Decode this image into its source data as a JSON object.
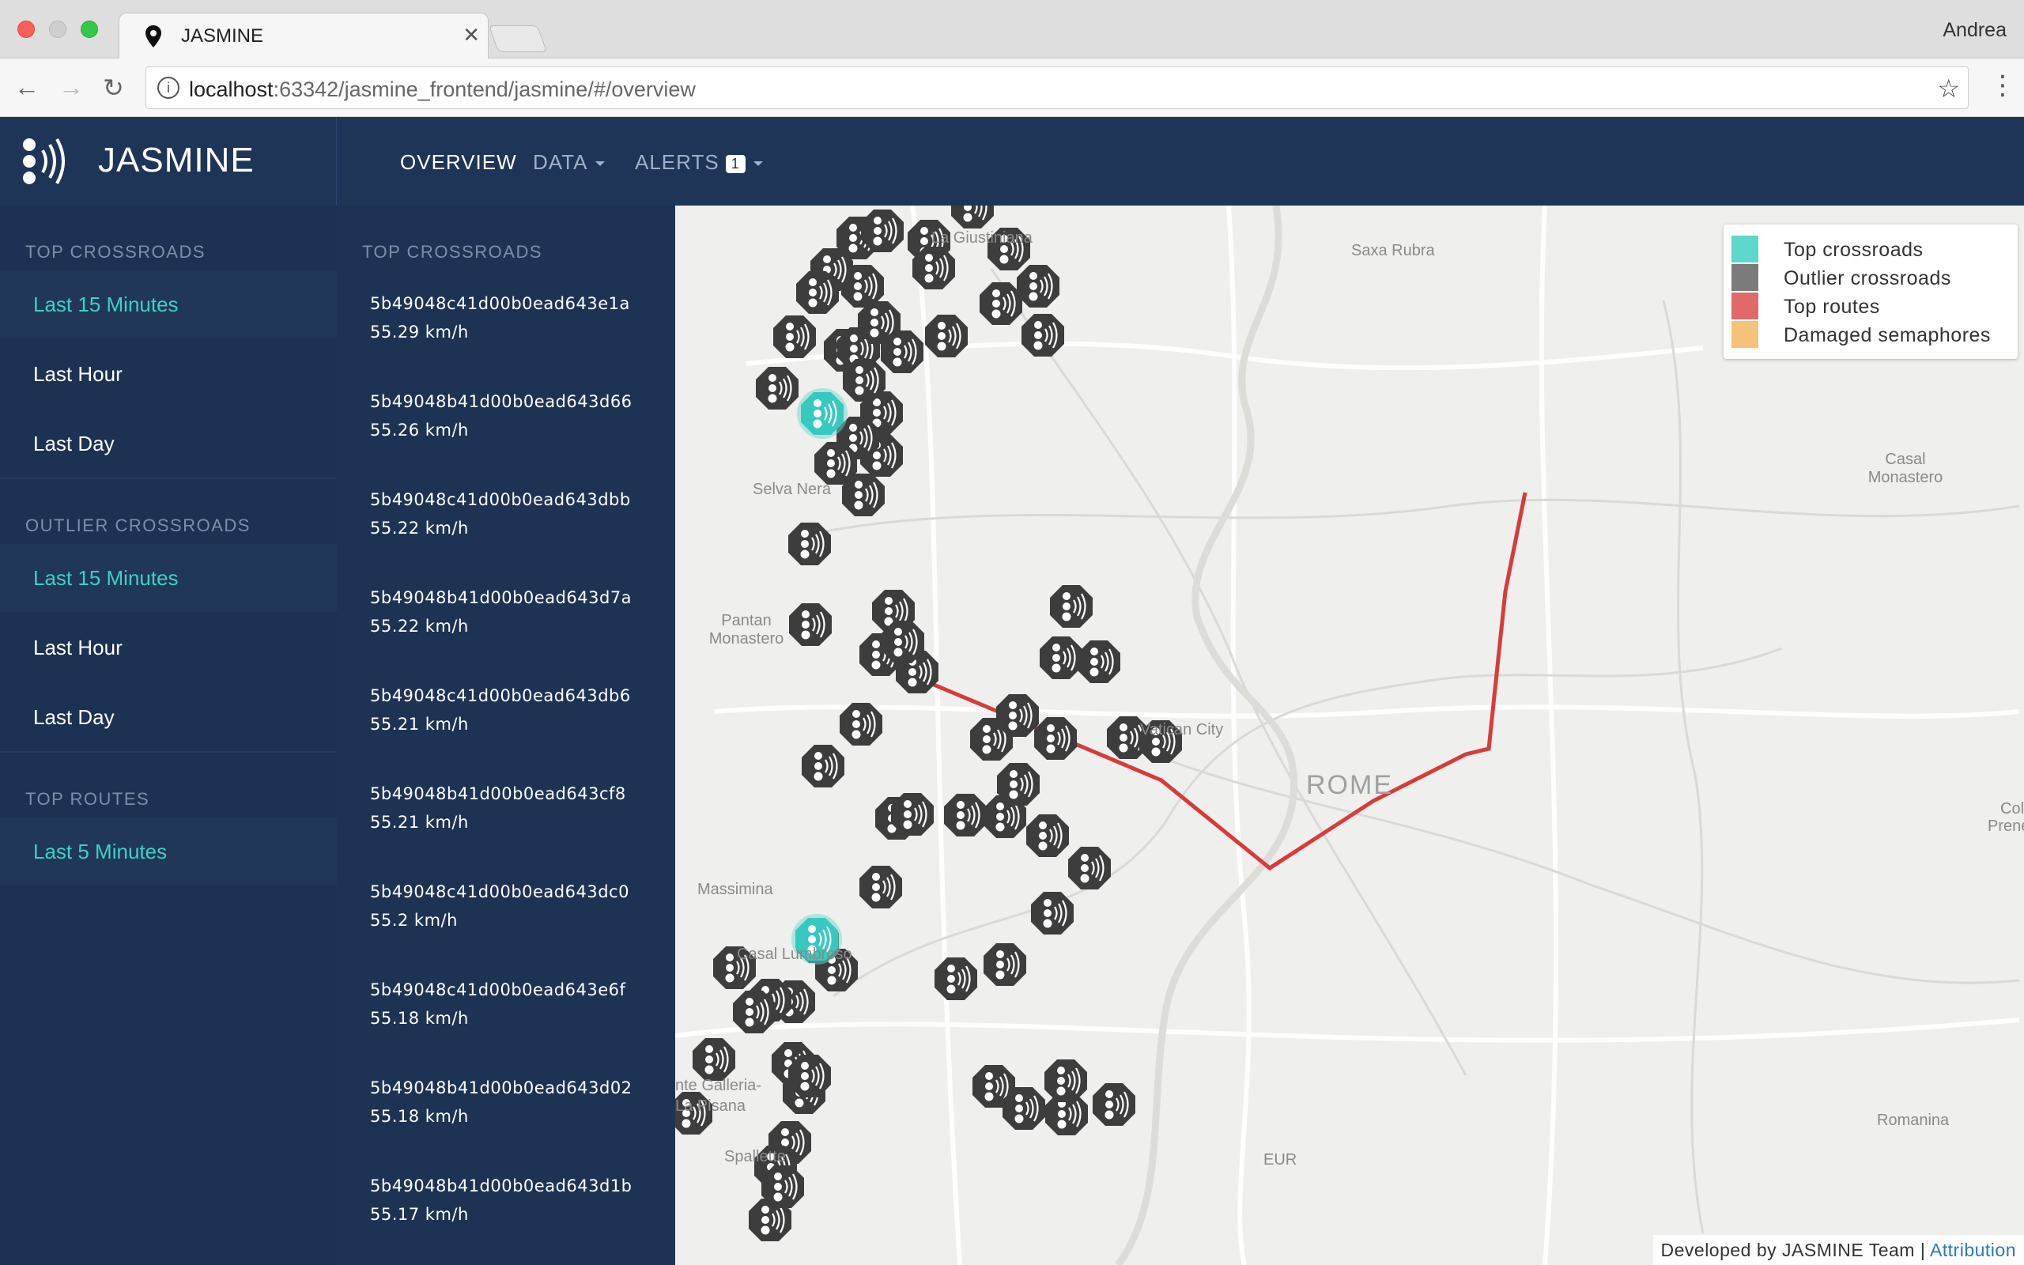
{
  "browser": {
    "tab_title": "JASMINE",
    "user": "Andrea",
    "url_host": "localhost",
    "url_rest": ":63342/jasmine_frontend/jasmine/#/overview"
  },
  "navbar": {
    "brand": "JASMINE",
    "items": [
      {
        "label": "OVERVIEW"
      },
      {
        "label": "DATA"
      },
      {
        "label": "ALERTS",
        "badge": "1"
      }
    ]
  },
  "sidebar": {
    "sections": [
      {
        "heading": "TOP CROSSROADS",
        "items": [
          "Last 15 Minutes",
          "Last Hour",
          "Last Day"
        ],
        "active": 0
      },
      {
        "heading": "OUTLIER CROSSROADS",
        "items": [
          "Last 15 Minutes",
          "Last Hour",
          "Last Day"
        ],
        "active": 0
      },
      {
        "heading": "TOP ROUTES",
        "items": [
          "Last 5 Minutes"
        ],
        "active": 0
      }
    ]
  },
  "list": {
    "heading": "TOP CROSSROADS",
    "items": [
      {
        "id": "5b49048c41d00b0ead643e1a",
        "speed": "55.29 km/h"
      },
      {
        "id": "5b49048b41d00b0ead643d66",
        "speed": "55.26 km/h"
      },
      {
        "id": "5b49048c41d00b0ead643dbb",
        "speed": "55.22 km/h"
      },
      {
        "id": "5b49048b41d00b0ead643d7a",
        "speed": "55.22 km/h"
      },
      {
        "id": "5b49048c41d00b0ead643db6",
        "speed": "55.21 km/h"
      },
      {
        "id": "5b49048b41d00b0ead643cf8",
        "speed": "55.21 km/h"
      },
      {
        "id": "5b49048c41d00b0ead643dc0",
        "speed": "55.2 km/h"
      },
      {
        "id": "5b49048c41d00b0ead643e6f",
        "speed": "55.18 km/h"
      },
      {
        "id": "5b49048b41d00b0ead643d02",
        "speed": "55.18 km/h"
      },
      {
        "id": "5b49048b41d00b0ead643d1b",
        "speed": "55.17 km/h"
      }
    ]
  },
  "map": {
    "places": [
      "La Giustiniana",
      "Saxa Rubra",
      "Selva Nera",
      "Casal Monastero",
      "Pantan Monastero",
      "Vatican City",
      "ROME",
      "Massimina",
      "Casal Lumbroso",
      "nte Galleria-",
      "La Pisana",
      "Spallette",
      "EUR",
      "Romanina",
      "Col",
      "Prene"
    ],
    "legend": [
      {
        "label": "Top crossroads",
        "color": "#5dd6cb"
      },
      {
        "label": "Outlier crossroads",
        "color": "#7b7b7b"
      },
      {
        "label": "Top routes",
        "color": "#e06a6a"
      },
      {
        "label": "Damaged semaphores",
        "color": "#f6c27a"
      }
    ],
    "footer_text": "Developed by JASMINE Team | ",
    "footer_link": "Attribution"
  }
}
